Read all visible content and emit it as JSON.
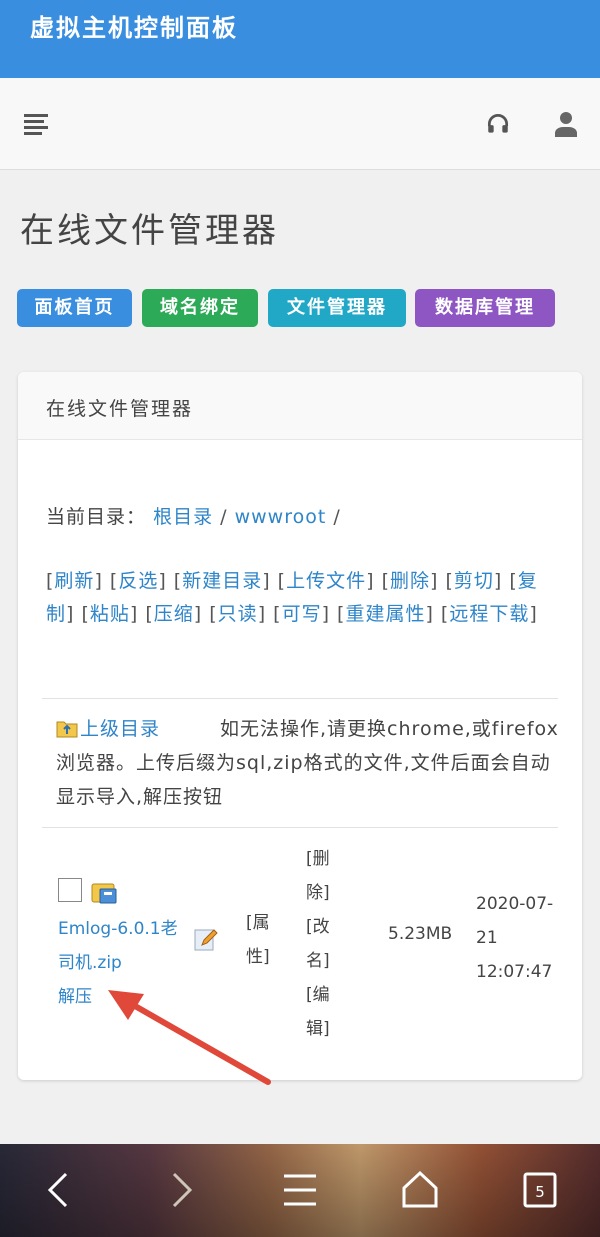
{
  "app": {
    "title": "虚拟主机控制面板"
  },
  "navbar": {
    "menu_icon": "menu-icon",
    "headset_icon": "headset-icon",
    "user_icon": "user-icon"
  },
  "page": {
    "title": "在线文件管理器"
  },
  "quick_buttons": [
    {
      "label": "面板首页",
      "color": "#3a8ee0"
    },
    {
      "label": "域名绑定",
      "color": "#2daa57"
    },
    {
      "label": "文件管理器",
      "color": "#20a8c6"
    },
    {
      "label": "数据库管理",
      "color": "#8e56c2"
    }
  ],
  "card": {
    "header": "在线文件管理器",
    "breadcrumb": {
      "label": "当前目录：",
      "items": [
        "根目录",
        "wwwroot"
      ],
      "separator": "/"
    },
    "actions": [
      "刷新",
      "反选",
      "新建目录",
      "上传文件",
      "删除",
      "剪切",
      "复制",
      "粘贴",
      "压缩",
      "只读",
      "可写",
      "重建属性",
      "远程下载"
    ],
    "parent_dir": {
      "label": "上级目录",
      "note": "如无法操作,请更换chrome,或firefox浏览器。上传后缀为sql,zip格式的文件,文件后面会自动显示导入,解压按钮"
    },
    "files": [
      {
        "name": "Emlog-6.0.1老司机.zip",
        "action": "解压",
        "attr_label": "[属性]",
        "ops": [
          "[删除]",
          "[改名]",
          "[编辑]"
        ],
        "size": "5.23MB",
        "date": "2020-07-21 12:07:47"
      }
    ]
  },
  "browser_nav": {
    "icons": [
      "back-icon",
      "forward-icon",
      "menu-icon",
      "home-icon",
      "tabs-icon"
    ],
    "tab_count": "5"
  },
  "colors": {
    "primary": "#3a8ee0",
    "link": "#2f85c9",
    "annotation": "#e0483a"
  }
}
